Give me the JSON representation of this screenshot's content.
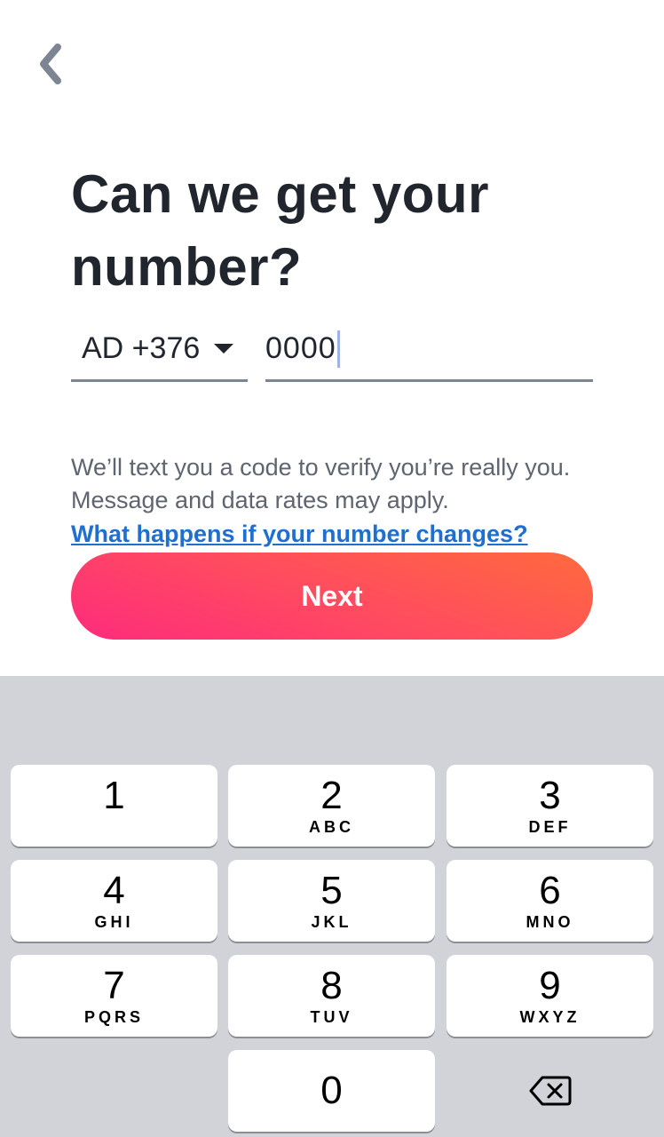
{
  "header": {
    "back_icon": "chevron-left-icon"
  },
  "title": "Can we get your number?",
  "phone": {
    "country_code": "AD +376",
    "number_value": "0000"
  },
  "disclaimer": "We’ll text you a code to verify you’re really you. Message and data rates may apply.",
  "help_link": "What happens if your number changes?",
  "next_label": "Next",
  "colors": {
    "title": "#21262e",
    "link": "#1f6fd1",
    "button_gradient_start": "#fe2b7c",
    "button_gradient_end": "#ff6a3d",
    "keyboard_bg": "#d2d3d8"
  },
  "keypad": {
    "keys": [
      {
        "digit": "1",
        "letters": ""
      },
      {
        "digit": "2",
        "letters": "ABC"
      },
      {
        "digit": "3",
        "letters": "DEF"
      },
      {
        "digit": "4",
        "letters": "GHI"
      },
      {
        "digit": "5",
        "letters": "JKL"
      },
      {
        "digit": "6",
        "letters": "MNO"
      },
      {
        "digit": "7",
        "letters": "PQRS"
      },
      {
        "digit": "8",
        "letters": "TUV"
      },
      {
        "digit": "9",
        "letters": "WXYZ"
      },
      {
        "digit": "0",
        "letters": ""
      }
    ],
    "delete_icon": "backspace-icon"
  }
}
